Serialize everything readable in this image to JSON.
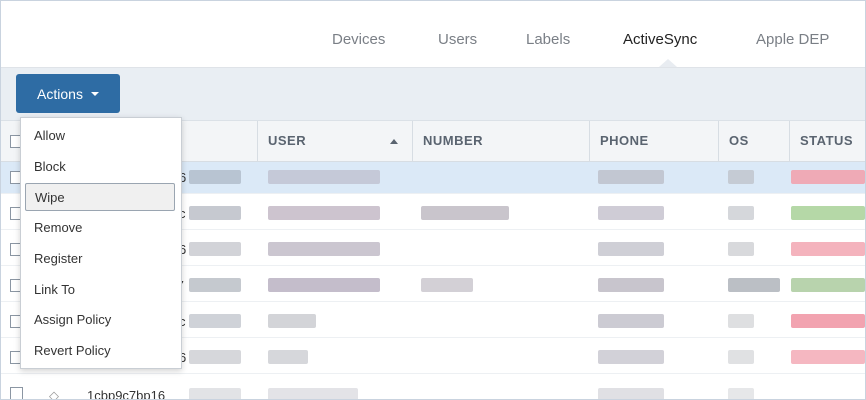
{
  "nav": {
    "tabs": [
      {
        "label": "Devices"
      },
      {
        "label": "Users"
      },
      {
        "label": "Labels"
      },
      {
        "label": "ActiveSync"
      },
      {
        "label": "Apple DEP"
      }
    ],
    "active": "ActiveSync"
  },
  "toolbar": {
    "actions_label": "Actions"
  },
  "table": {
    "columns": [
      "USER",
      "NUMBER",
      "PHONE",
      "OS",
      "STATUS"
    ],
    "sort_column": "USER",
    "row_fragments": [
      "6",
      "c",
      "6",
      "f7",
      "c",
      "6",
      "1cbp9c7bp16"
    ]
  },
  "menu": {
    "items": [
      "Allow",
      "Block",
      "Wipe",
      "Remove",
      "Register",
      "Link To",
      "Assign Policy",
      "Revert Policy"
    ],
    "highlighted": "Wipe"
  },
  "colors": {
    "accent": "#2e6ca4",
    "selected_row": "#dbe9f7",
    "status_red": "#f2a3b0",
    "status_green": "#b5d8a7"
  }
}
